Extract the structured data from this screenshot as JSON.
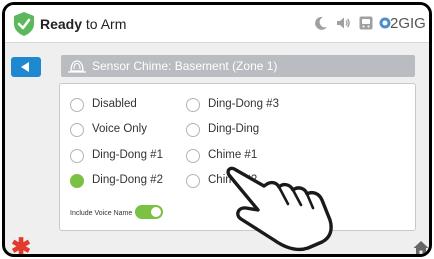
{
  "status": {
    "title_bold": "Ready",
    "title_rest": " to Arm",
    "brand": "2GIG",
    "icons": [
      "shield-check-icon",
      "moon-icon",
      "speaker-icon",
      "panel-icon",
      "brand-logo-icon"
    ]
  },
  "header": {
    "back_icon": "back-arrow-icon",
    "title": "Sensor Chime: Basement (Zone 1)",
    "title_icon": "chime-bell-icon"
  },
  "options": [
    {
      "label": "Disabled",
      "selected": false
    },
    {
      "label": "Ding-Dong #3",
      "selected": false
    },
    {
      "label": "Voice Only",
      "selected": false
    },
    {
      "label": "Ding-Ding",
      "selected": false
    },
    {
      "label": "Ding-Dong #1",
      "selected": false
    },
    {
      "label": "Chime #1",
      "selected": false
    },
    {
      "label": "Ding-Dong #2",
      "selected": true
    },
    {
      "label": "Chime #2",
      "selected": false
    }
  ],
  "voice_name": {
    "label": "Include Voice Name",
    "enabled": true
  },
  "footer": {
    "star_icon": "emergency-star-icon",
    "home_icon": "home-icon",
    "star_symbol": "✱"
  },
  "colors": {
    "accent": "#1e88d0",
    "selected": "#7bc143",
    "emergency": "#e23a2e",
    "header_bar": "#b9bcc0"
  }
}
